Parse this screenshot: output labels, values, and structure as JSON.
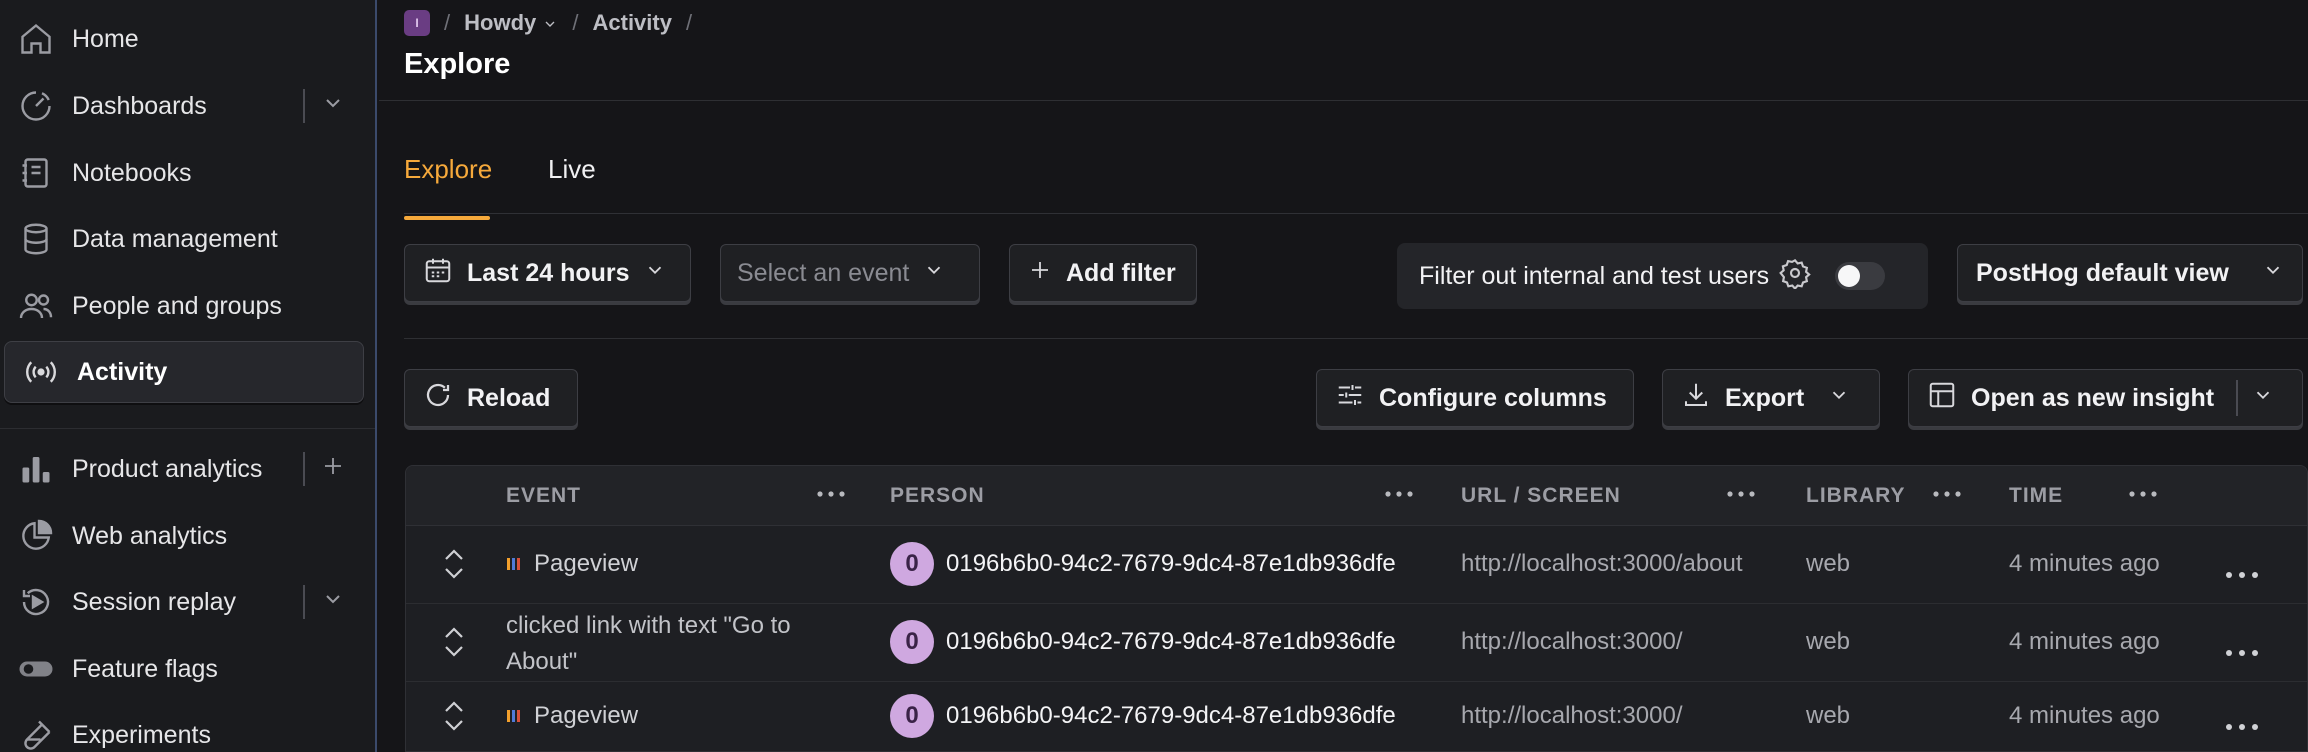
{
  "sidebar": {
    "items": [
      {
        "label": "Home",
        "icon": "home-icon"
      },
      {
        "label": "Dashboards",
        "icon": "dashboard-icon",
        "has_chevron": true
      },
      {
        "label": "Notebooks",
        "icon": "notebook-icon"
      },
      {
        "label": "Data management",
        "icon": "database-icon"
      },
      {
        "label": "People and groups",
        "icon": "people-icon"
      },
      {
        "label": "Activity",
        "icon": "activity-icon",
        "active": true
      },
      {
        "label": "Product analytics",
        "icon": "bar-chart-icon",
        "has_plus": true
      },
      {
        "label": "Web analytics",
        "icon": "pie-chart-icon"
      },
      {
        "label": "Session replay",
        "icon": "replay-icon",
        "has_chevron": true
      },
      {
        "label": "Feature flags",
        "icon": "toggle-icon"
      },
      {
        "label": "Experiments",
        "icon": "flask-icon"
      }
    ]
  },
  "breadcrumb": {
    "project_initial": "I",
    "project": "Howdy",
    "section": "Activity",
    "separator": "/"
  },
  "page": {
    "title": "Explore"
  },
  "tabs": [
    {
      "label": "Explore",
      "active": true
    },
    {
      "label": "Live",
      "active": false
    }
  ],
  "filters": {
    "date_range": "Last 24 hours",
    "event_placeholder": "Select an event",
    "add_filter": "Add filter",
    "internal_users_label": "Filter out internal and test users",
    "internal_users_toggle": false,
    "view": "PostHog default view"
  },
  "toolbar": {
    "reload": "Reload",
    "configure_columns": "Configure columns",
    "export": "Export",
    "open_insight": "Open as new insight"
  },
  "table": {
    "columns": [
      "EVENT",
      "PERSON",
      "URL / SCREEN",
      "LIBRARY",
      "TIME"
    ],
    "rows": [
      {
        "event": "Pageview",
        "event_icon": "pageview-icon",
        "person_initial": "0",
        "person": "0196b6b0-94c2-7679-9dc4-87e1db936dfe",
        "url": "http://localhost:3000/about",
        "library": "web",
        "time": "4 minutes ago"
      },
      {
        "event": "clicked link with text \"Go to About\"",
        "event_icon": "",
        "person_initial": "0",
        "person": "0196b6b0-94c2-7679-9dc4-87e1db936dfe",
        "url": "http://localhost:3000/",
        "library": "web",
        "time": "4 minutes ago"
      },
      {
        "event": "Pageview",
        "event_icon": "pageview-icon",
        "person_initial": "0",
        "person": "0196b6b0-94c2-7679-9dc4-87e1db936dfe",
        "url": "http://localhost:3000/",
        "library": "web",
        "time": "4 minutes ago"
      }
    ]
  },
  "colors": {
    "accent": "#f6a93b",
    "avatar": "#cfa8e0",
    "project_badge": "#6a3d83"
  }
}
